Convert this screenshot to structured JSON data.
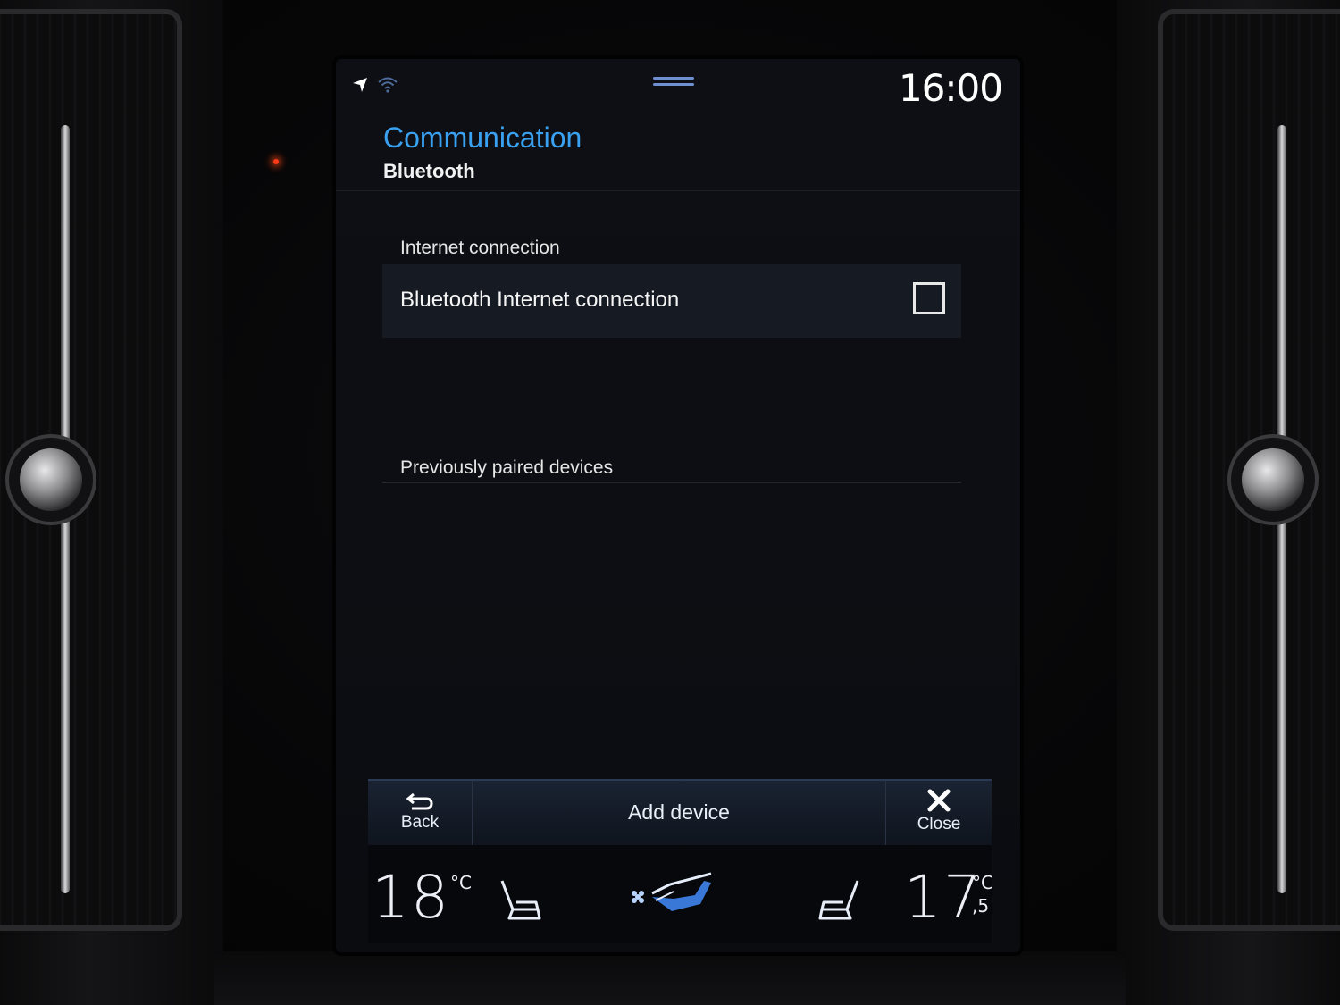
{
  "status_bar": {
    "clock": "16:00"
  },
  "header": {
    "title": "Communication",
    "subtitle": "Bluetooth"
  },
  "sections": {
    "internet_label": "Internet connection",
    "bluetooth_internet": {
      "label": "Bluetooth Internet connection",
      "checked": false
    },
    "paired_label": "Previously paired devices"
  },
  "action_bar": {
    "back_label": "Back",
    "add_label": "Add device",
    "close_label": "Close"
  },
  "climate": {
    "driver_temp": "18",
    "driver_unit": "°C",
    "passenger_temp": "17",
    "passenger_unit": "°C",
    "passenger_decimal": ",5"
  },
  "colors": {
    "accent": "#3aa0f0",
    "background": "#0d0f14",
    "row": "#161a22"
  }
}
